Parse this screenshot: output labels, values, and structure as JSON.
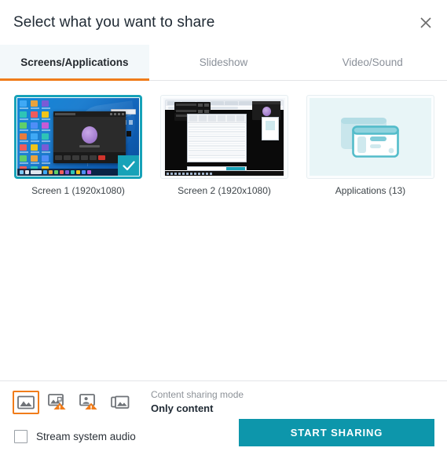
{
  "dialog": {
    "title": "Select what you want to share",
    "close_icon": "close-icon"
  },
  "tabs": [
    {
      "label": "Screens/Applications",
      "active": true
    },
    {
      "label": "Slideshow",
      "active": false
    },
    {
      "label": "Video/Sound",
      "active": false
    }
  ],
  "sources": [
    {
      "label": "Screen 1 (1920x1080)",
      "kind": "screen",
      "selected": true,
      "badge_icon": "check-icon"
    },
    {
      "label": "Screen 2 (1920x1080)",
      "kind": "screen",
      "selected": false
    },
    {
      "label": "Applications (13)",
      "kind": "applications",
      "selected": false,
      "tile_icon": "windows-stack-icon"
    }
  ],
  "footer": {
    "mode_icons": [
      {
        "name": "only-content-icon",
        "active": true,
        "warning": false
      },
      {
        "name": "content-with-frame-warning-icon",
        "active": false,
        "warning": true
      },
      {
        "name": "content-with-presenter-warning-icon",
        "active": false,
        "warning": true
      },
      {
        "name": "content-multi-layer-icon",
        "active": false,
        "warning": false
      }
    ],
    "mode_label": "Content sharing mode",
    "mode_value": "Only content",
    "stream_audio_label": "Stream system audio",
    "stream_audio_checked": false,
    "start_button": "START SHARING"
  },
  "colors": {
    "accent_orange": "#f07c1a",
    "accent_teal": "#0d96ab",
    "badge_teal": "#17a2b8",
    "text_dark": "#1f2933",
    "text_muted": "#8a9099"
  }
}
